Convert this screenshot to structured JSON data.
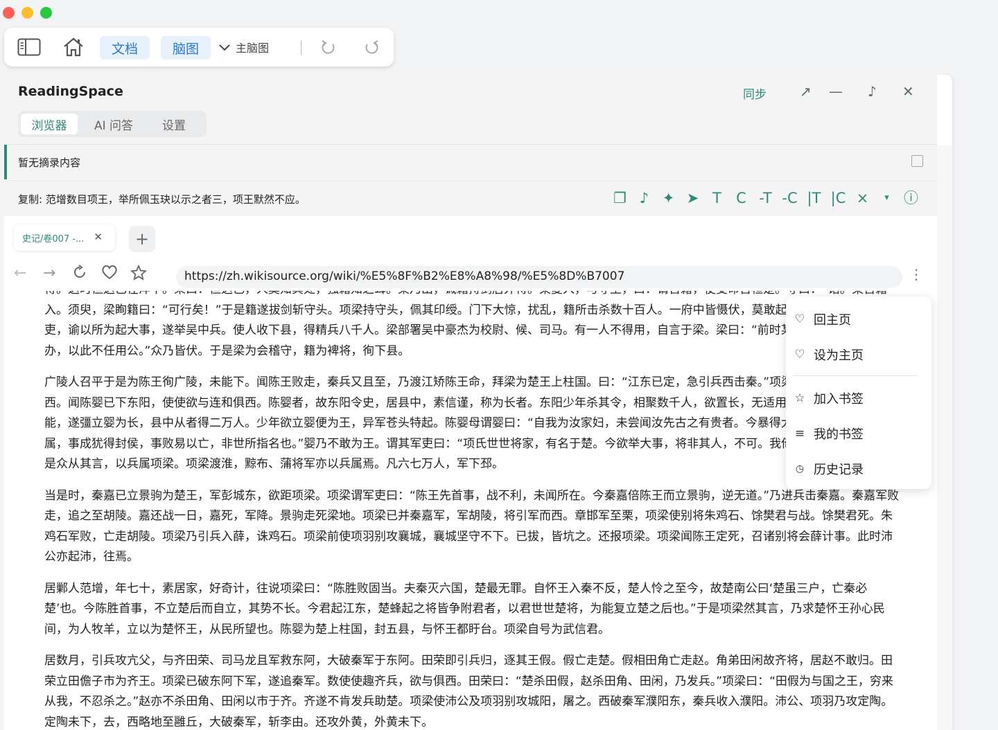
{
  "toolbar": {
    "doc_label": "文档",
    "mindmap_label": "脑图",
    "main_mindmap_label": "主脑图"
  },
  "panel": {
    "title": "ReadingSpace",
    "sync_label": "同步",
    "tabs": [
      {
        "label": "浏览器",
        "active": true
      },
      {
        "label": "AI 问答",
        "active": false
      },
      {
        "label": "设置",
        "active": false
      }
    ]
  },
  "excerpt": {
    "text": "暂无摘录内容"
  },
  "copy": {
    "text": "复制: 范增数目项王，举所佩玉玦以示之者三，项王默然不应。",
    "tools": [
      "❐",
      "♪",
      "✦",
      "➤",
      "T",
      "C",
      "-T",
      "-C",
      "|T",
      "|C",
      "×",
      "▾",
      "ⓘ"
    ]
  },
  "browser": {
    "tab_label": "史记/卷007 -...",
    "url": "https://zh.wikisource.org/wiki/%E5%8F%B2%E8%A8%98/%E5%8D%B7007"
  },
  "menu": {
    "items": [
      {
        "icon": "heart-icon",
        "label": "回主页"
      },
      {
        "icon": "heart-icon",
        "label": "设为主页"
      },
      {
        "icon": "star-icon",
        "label": "加入书签"
      },
      {
        "icon": "list-icon",
        "label": "我的书签"
      },
      {
        "icon": "clock-icon",
        "label": "历史记录"
      }
    ]
  },
  "content": {
    "paragraphs": [
      "得。这时但这已在洋中。果曰：但这已，人莫知其处，独籍知之耳。梁乃出，诫籍持剑居外待。梁复入，与守坐，曰：请召籍，使受命召桓楚。守曰：“诺。”梁召籍入。须臾，梁眴籍曰：“可行矣！”于是籍遂拔剑斩守头。项梁持守头，佩其印绶。门下大惊，扰乱，籍所击杀数十百人。一府中皆慑伏，莫敢起。梁乃召故所知豪吏，谕以所为起大事，遂举吴中兵。使人收下县，得精兵八千人。梁部署吴中豪杰为校尉、候、司马。有一人不得用，自言于梁。梁曰：“前时某丧使公主某事，不能办，以此不任用公。”众乃皆伏。于是梁为会稽守，籍为裨将，徇下县。",
      "广陵人召平于是为陈王徇广陵，未能下。闻陈王败走，秦兵又且至，乃渡江矫陈王命，拜梁为楚王上柱国。曰：“江东已定，急引兵西击秦。”项梁乃以八千人渡江而西。闻陈婴已下东阳，使使欲与连和俱西。陈婴者，故东阳令史，居县中，素信谨，称为长者。东阳少年杀其令，相聚数千人，欲置长，无适用，乃请陈婴。婴谢不能，遂彊立婴为长，县中从者得二万人。少年欲立婴便为王，异军苍头特起。陈婴母谓婴曰：“自我为汝家妇，未尝闻汝先古之有贵者。今暴得大名，不祥。不如有所属，事成犹得封侯，事败易以亡，非世所指名也。”婴乃不敢为王。谓其军吏曰：“项氏世世将家，有名于楚。今欲举大事，将非其人，不可。我倚名族，亡秦必矣。”于是众从其言，以兵属项梁。项梁渡淮，黥布、蒲将军亦以兵属焉。凡六七万人，军下邳。",
      "当是时，秦嘉已立景驹为楚王，军彭城东，欲距项梁。项梁谓军吏曰：“陈王先首事，战不利，未闻所在。今秦嘉倍陈王而立景驹，逆无道。”乃进兵击秦嘉。秦嘉军败走，追之至胡陵。嘉还战一日，嘉死，军降。景驹走死梁地。项梁已并秦嘉军，军胡陵，将引军而西。章邯军至栗，项梁使别将朱鸡石、馀樊君与战。馀樊君死。朱鸡石军败，亡走胡陵。项梁乃引兵入薛，诛鸡石。项梁前使项羽别攻襄城，襄城坚守不下。已拔，皆坑之。还报项梁。项梁闻陈王定死，召诸别将会薛计事。此时沛公亦起沛，往焉。",
      "居鄛人范增，年七十，素居家，好奇计，往说项梁曰：“陈胜败固当。夫秦灭六国，楚最无罪。自怀王入秦不反，楚人怜之至今，故楚南公曰‘楚虽三户，亡秦必楚’也。今陈胜首事，不立楚后而自立，其势不长。今君起江东，楚蜂起之将皆争附君者，以君世世楚将，为能复立楚之后也。”于是项梁然其言，乃求楚怀王孙心民间，为人牧羊，立以为楚怀王，从民所望也。陈婴为楚上柱国，封五县，与怀王都盱台。项梁自号为武信君。",
      "居数月，引兵攻亢父，与齐田荣、司马龙且军救东阿，大破秦军于东阿。田荣即引兵归，逐其王假。假亡走楚。假相田角亡走赵。角弟田闲故齐将，居赵不敢归。田荣立田儋子市为齐王。项梁已破东阿下军，遂追秦军。数使使趣齐兵，欲与俱西。田荣曰：“楚杀田假，赵杀田角、田闲，乃发兵。”项梁曰：“田假为与国之王，穷来从我，不忍杀之。”赵亦不杀田角、田闲以市于齐。齐遂不肯发兵助楚。项梁使沛公及项羽别攻城阳，屠之。西破秦军濮阳东，秦兵收入濮阳。沛公、项羽乃攻定陶。定陶未下，去，西略地至雝丘，大破秦军，斩李由。还攻外黄，外黄未下。"
    ]
  }
}
